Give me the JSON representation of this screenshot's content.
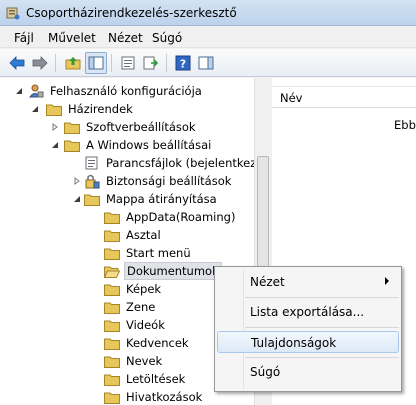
{
  "window": {
    "title": "Csoportházirendkezelés-szerkesztő"
  },
  "menu": [
    "Fájl",
    "Művelet",
    "Nézet",
    "Súgó"
  ],
  "toolbar": {
    "icons": [
      "back-arrow-icon",
      "forward-arrow-icon",
      "up-folder-icon",
      "show-tree-icon",
      "properties-icon",
      "export-list-icon",
      "help-icon",
      "show-pane-icon"
    ]
  },
  "tree": {
    "items": [
      {
        "label": "Felhasználó konfigurációja"
      },
      {
        "label": "Házirendek"
      },
      {
        "label": "Szoftverbeállítások"
      },
      {
        "label": "A Windows beállításai"
      },
      {
        "label": "Parancsfájlok (bejelentkezés"
      },
      {
        "label": "Biztonsági beállítások"
      },
      {
        "label": "Mappa átirányítása"
      },
      {
        "label": "AppData(Roaming)"
      },
      {
        "label": "Asztal"
      },
      {
        "label": "Start menü"
      },
      {
        "label": "Dokumentumok"
      },
      {
        "label": "Képek"
      },
      {
        "label": "Zene"
      },
      {
        "label": "Videók"
      },
      {
        "label": "Kedvencek"
      },
      {
        "label": "Nevek"
      },
      {
        "label": "Letöltések"
      },
      {
        "label": "Hivatkozások"
      }
    ]
  },
  "list": {
    "column_header": "Név",
    "text": "Ebb"
  },
  "context_menu": {
    "items": [
      {
        "label": "Nézet"
      },
      {
        "label": "Lista exportálása..."
      },
      {
        "label": "Tulajdonságok"
      },
      {
        "label": "Súgó"
      }
    ]
  },
  "colors": {
    "folder": "#e8c75a",
    "selection": "#dfe3e8",
    "menu_hover": "#dde9f7"
  }
}
